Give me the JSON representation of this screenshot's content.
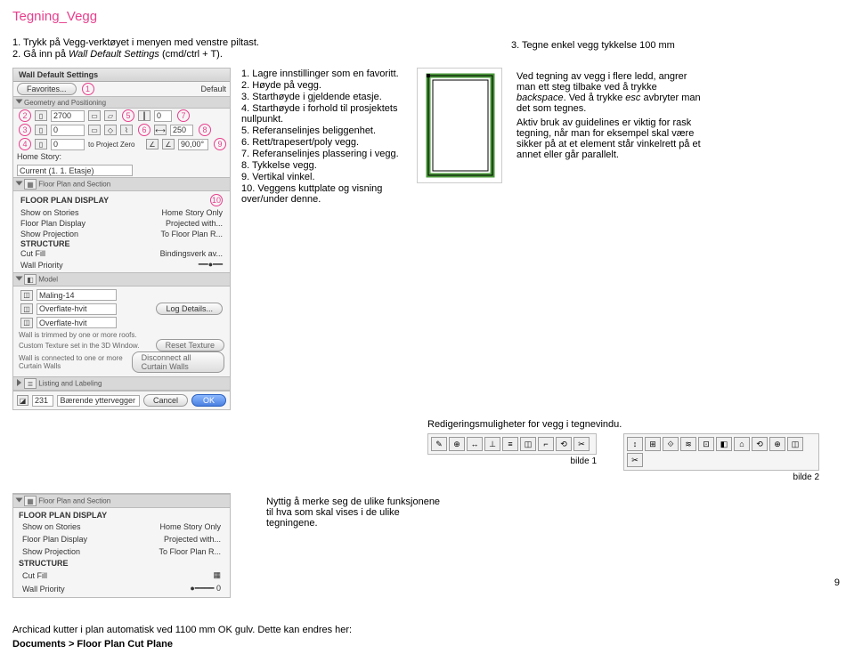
{
  "title": "Tegning_Vegg",
  "intro1": "1. Trykk på Vegg-verktøyet i menyen med venstre piltast.",
  "intro2_pre": "2. Gå inn på ",
  "intro2_it": "Wall Default Settings",
  "intro2_post": " (cmd/ctrl + T).",
  "intro3": "3. Tegne enkel vegg tykkelse 100 mm",
  "list": {
    "i1": "1. Lagre innstillinger som en favoritt.",
    "i2": "2. Høyde på vegg.",
    "i3": "3. Starthøyde i gjeldende etasje.",
    "i4": "4. Starthøyde i forhold til prosjektets nullpunkt.",
    "i5": "5. Referanselinjes beliggenhet.",
    "i6": "6. Rett/trapesert/poly vegg.",
    "i7": "7. Referanselinjes plassering i vegg.",
    "i8": "8. Tykkelse vegg.",
    "i9": "9. Vertikal vinkel.",
    "i10": "10. Veggens kuttplate og visning over/under denne."
  },
  "guides": {
    "p1a": "Ved tegning av vegg i flere ledd, angrer man ett steg tilbake ved å trykke ",
    "p1b": "backspace",
    "p1c": ". Ved å trykke ",
    "p1d": "esc",
    "p1e": " avbryter man det som tegnes.",
    "p2": "Aktiv bruk av guidelines er viktig for rask tegning, når man for eksempel skal være sikker på at et element står vinkelrett på et annet eller går parallelt."
  },
  "redig": "Redigeringsmuligheter for vegg i tegnevindu.",
  "bilde1": "bilde 1",
  "bilde2": "bilde 2",
  "note2": "Nyttig å merke seg de ulike funksjonene til hva som skal vises i de ulike tegningene.",
  "footer": {
    "l1": "Archicad kutter i plan automatisk ved 1100 mm OK gulv. Dette kan endres her:",
    "l2": "Documents > Floor Plan Cut Plane"
  },
  "page": "9",
  "panel": {
    "head": "Wall Default Settings",
    "fav": "Favorites...",
    "def": "Default",
    "geo": "Geometry and Positioning",
    "v2700": "2700",
    "v0a": "0",
    "v0b": "0",
    "v250": "250",
    "v0c": "0",
    "v0d": "0",
    "v90": "90,00°",
    "hs": "Home Story:",
    "hsv": "Current (1. 1. Etasje)",
    "toproj": "to Project Zero",
    "fps": "Floor Plan and Section",
    "fpd": "FLOOR PLAN DISPLAY",
    "show": "Show on Stories",
    "showv": "Home Story Only",
    "fdisp": "Floor Plan Display",
    "fdispv": "Projected with...",
    "sproj": "Show Projection",
    "sprojv": "To Floor Plan R...",
    "struct": "STRUCTURE",
    "cutf": "Cut Fill",
    "cutfv": "Bindingsverk av...",
    "wprio": "Wall Priority",
    "model": "Model",
    "mal": "Maling-14",
    "ov1": "Overflate-hvit",
    "ov2": "Overflate-hvit",
    "log": "Log Details...",
    "trim": "Wall is trimmed by one or more roofs.",
    "ct": "Custom Texture set in the 3D Window.",
    "cw": "Wall is connected to one or more Curtain Walls",
    "rt": "Reset Texture",
    "dcw": "Disconnect all Curtain Walls",
    "lab": "Listing and Labeling",
    "layernum": "231",
    "layer": "Bærende yttervegger",
    "cancel": "Cancel",
    "ok": "OK"
  },
  "panel2": {
    "fps": "Floor Plan and Section",
    "fpd": "FLOOR PLAN DISPLAY",
    "show": "Show on Stories",
    "showv": "Home Story Only",
    "fdisp": "Floor Plan Display",
    "fdispv": "Projected with...",
    "sproj": "Show Projection",
    "sprojv": "To Floor Plan R...",
    "struct": "STRUCTURE",
    "cutf": "Cut Fill",
    "wprio": "Wall Priority",
    "wpriov": "0"
  }
}
